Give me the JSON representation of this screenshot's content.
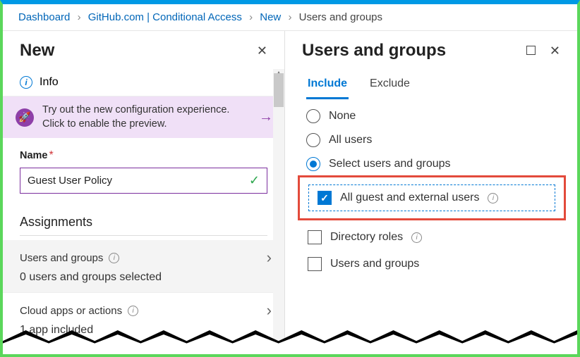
{
  "breadcrumb": {
    "dashboard": "Dashboard",
    "app": "GitHub.com | Conditional Access",
    "new": "New",
    "current": "Users and groups"
  },
  "left": {
    "title": "New",
    "info": "Info",
    "promo": "Try out the new configuration experience. Click to enable the preview.",
    "name_label": "Name",
    "name_value": "Guest User Policy",
    "assignments_title": "Assignments",
    "item1_label": "Users and groups",
    "item1_sub": "0 users and groups selected",
    "item2_label": "Cloud apps or actions",
    "item2_sub": "1 app included"
  },
  "right": {
    "title": "Users and groups",
    "tab_include": "Include",
    "tab_exclude": "Exclude",
    "opt_none": "None",
    "opt_all": "All users",
    "opt_select": "Select users and groups",
    "cb_guest": "All guest and external users",
    "cb_roles": "Directory roles",
    "cb_ug": "Users and groups"
  }
}
